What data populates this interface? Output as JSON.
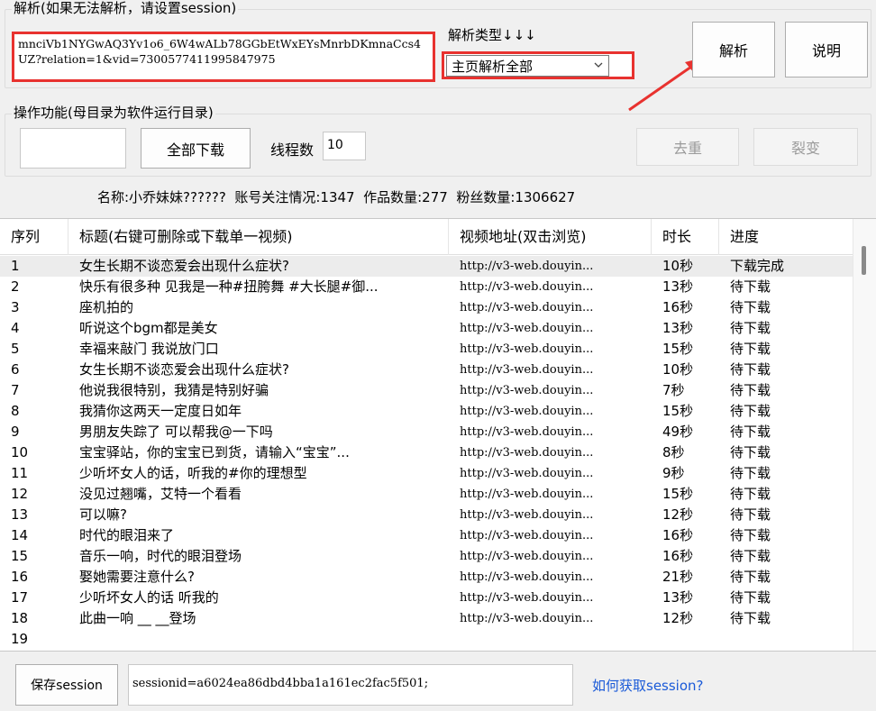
{
  "parse_group": {
    "title": "解析(如果无法解析，请设置session)",
    "url_value": "mnciVb1NYGwAQ3Yv1o6_6W4wALb78GGbEtWxEYsMnrbDKmnaCcs4UZ?relation=1&vid=7300577411995847975",
    "type_label": "解析类型↓↓↓",
    "type_selected": "主页解析全部",
    "parse_button": "解析",
    "help_button": "说明"
  },
  "ops_group": {
    "title": "操作功能(母目录为软件运行目录)",
    "download_all": "全部下载",
    "threads_label": "线程数",
    "threads_value": "10",
    "dedupe_button": "去重",
    "split_button": "裂变"
  },
  "account_info": "名称:小乔妹妹??????  账号关注情况:1347  作品数量:277  粉丝数量:1306627",
  "table": {
    "headers": [
      "序列",
      "标题(右键可删除或下载单一视频)",
      "视频地址(双击浏览)",
      "时长",
      "进度"
    ],
    "rows": [
      [
        "1",
        "女生长期不谈恋爱会出现什么症状?",
        "http://v3-web.douyin...",
        "10秒",
        "下载完成"
      ],
      [
        "2",
        "快乐有很多种 见我是一种#扭胯舞 #大长腿#御...",
        "http://v3-web.douyin...",
        "13秒",
        "待下载"
      ],
      [
        "3",
        "座机拍的",
        "http://v3-web.douyin...",
        "16秒",
        "待下载"
      ],
      [
        "4",
        "听说这个bgm都是美女",
        "http://v3-web.douyin...",
        "13秒",
        "待下载"
      ],
      [
        "5",
        "幸福来敲门 我说放门口",
        "http://v3-web.douyin...",
        "15秒",
        "待下载"
      ],
      [
        "6",
        "女生长期不谈恋爱会出现什么症状?",
        "http://v3-web.douyin...",
        "10秒",
        "待下载"
      ],
      [
        "7",
        "他说我很特别，我猜是特别好骗",
        "http://v3-web.douyin...",
        "7秒",
        "待下载"
      ],
      [
        "8",
        "我猜你这两天一定度日如年",
        "http://v3-web.douyin...",
        "15秒",
        "待下载"
      ],
      [
        "9",
        "男朋友失踪了 可以帮我@一下吗",
        "http://v3-web.douyin...",
        "49秒",
        "待下载"
      ],
      [
        "10",
        "宝宝驿站，你的宝宝已到货，请输入“宝宝”...",
        "http://v3-web.douyin...",
        "8秒",
        "待下载"
      ],
      [
        "11",
        "少听坏女人的话，听我的#你的理想型",
        "http://v3-web.douyin...",
        "9秒",
        "待下载"
      ],
      [
        "12",
        "没见过翘嘴，艾特一个看看",
        "http://v3-web.douyin...",
        "15秒",
        "待下载"
      ],
      [
        "13",
        "可以嘛?",
        "http://v3-web.douyin...",
        "12秒",
        "待下载"
      ],
      [
        "14",
        "时代的眼泪来了",
        "http://v3-web.douyin...",
        "16秒",
        "待下载"
      ],
      [
        "15",
        "音乐一响，时代的眼泪登场",
        "http://v3-web.douyin...",
        "16秒",
        "待下载"
      ],
      [
        "16",
        "娶她需要注意什么?",
        "http://v3-web.douyin...",
        "21秒",
        "待下载"
      ],
      [
        "17",
        "少听坏女人的话 听我的",
        "http://v3-web.douyin...",
        "13秒",
        "待下载"
      ],
      [
        "18",
        "此曲一响 __ __登场",
        "http://v3-web.douyin...",
        "12秒",
        "待下载"
      ],
      [
        "19",
        "",
        "",
        "",
        ""
      ]
    ]
  },
  "session": {
    "save_button": "保存session",
    "value": "sessionid=a6024ea86dbd4bba1a161ec2fac5f501;",
    "help_link": "如何获取session?"
  },
  "colors": {
    "highlight": "#e8322f",
    "link": "#1a5ad8"
  }
}
